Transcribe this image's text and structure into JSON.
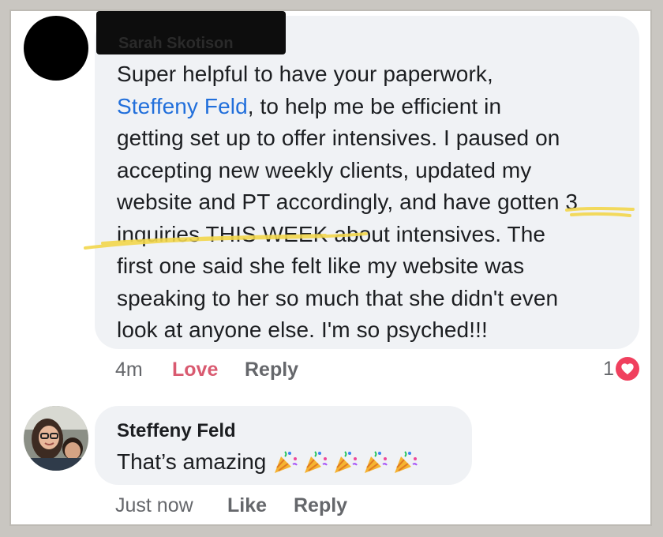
{
  "comment": {
    "author_redacted": "Sarah Skotison",
    "lines": [
      "Super helpful to have your paperwork,",
      "Steffeny Feld",
      ", to help me be efficient in",
      "getting set up to offer intensives. I paused on",
      "accepting new weekly clients, updated my",
      "website and PT accordingly, and have gotten 3",
      "inquiries THIS WEEK about intensives. The",
      "first one said she felt like my website was",
      "speaking to her so much that she didn't even",
      "look at anyone else. I'm so psyched!!!"
    ],
    "time": "4m",
    "love_label": "Love",
    "reply_label": "Reply",
    "reaction_count": "1",
    "reaction_icon": "heart-icon",
    "highlight_color": "#f2d64b"
  },
  "reply": {
    "author": "Steffeny Feld",
    "text": "That’s amazing",
    "emoji": [
      "party-popper-icon",
      "party-popper-icon",
      "party-popper-icon",
      "party-popper-icon",
      "party-popper-icon"
    ],
    "time": "Just now",
    "like_label": "Like",
    "reply_label": "Reply"
  }
}
